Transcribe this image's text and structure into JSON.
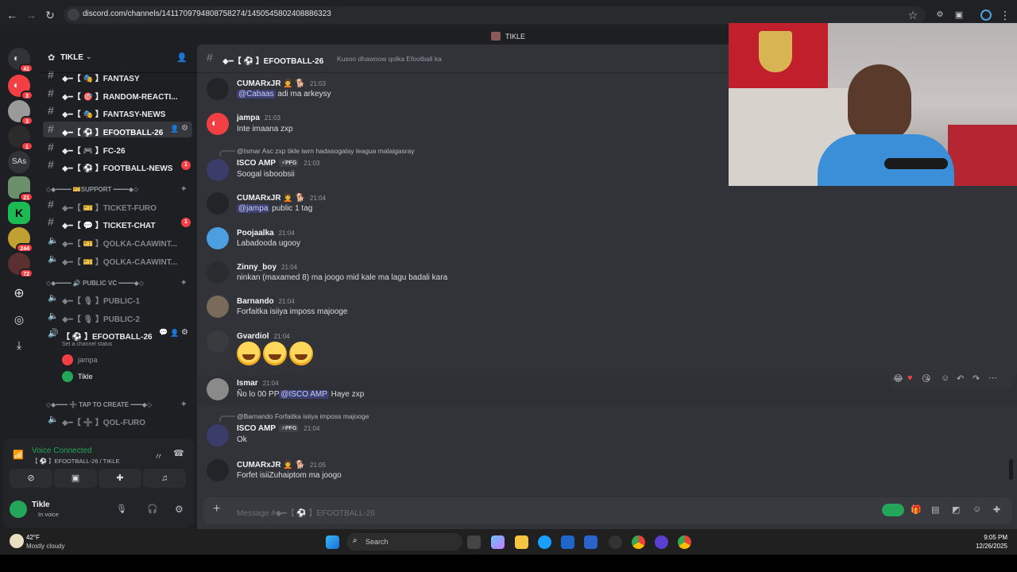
{
  "browser": {
    "url": "discord.com/channels/1411709794808758274/1450545802408886323"
  },
  "app": {
    "window_title": "TIKLE"
  },
  "servers": {
    "home_badge": "41",
    "badges": [
      "3",
      "3",
      "1",
      "21",
      "244",
      "72"
    ],
    "text_server": "SAs"
  },
  "server": {
    "name": "TIKLE"
  },
  "channels": {
    "items": [
      {
        "label": "◆━【 🎭 】FANTASY"
      },
      {
        "label": "◆━【 🎯 】RANDOM-REACTI..."
      },
      {
        "label": "◆━【 🎭 】FANTASY-NEWS"
      },
      {
        "label": "◆━【 ⚽ 】EFOOTBALL-26"
      },
      {
        "label": "◆━【 🎮 】FC-26"
      },
      {
        "label": "◆━【 ⚽ 】FOOTBALL-NEWS",
        "badge": "1"
      }
    ],
    "cat_support": "◇◆━━━━ 🎫SUPPORT ━━━━◆◇",
    "support_items": [
      {
        "label": "◆━【 🎫 】TICKET-FURO"
      },
      {
        "label": "◆━【 💬 】TICKET-CHAT",
        "badge": "1"
      },
      {
        "label": "◆━【 🎫 】QOLKA-CAAWINT..."
      },
      {
        "label": "◆━【 🎫 】QOLKA-CAAWINT..."
      }
    ],
    "cat_public_vc": "◇◆━━━━ 🔊 PUBLIC VC ━━━━◆◇",
    "vc_items": [
      {
        "label": "◆━【 🎙 】PUBLIC-1"
      },
      {
        "label": "◆━【 🎙 】PUBLIC-2"
      }
    ],
    "active_vc": "【 ⚽ 】EFOOTBALL-26",
    "vc_status": "Set a channel status",
    "vc_members": [
      "jampa",
      "Tikle"
    ],
    "cat_tap": "◇◆━━━ ➕ TAP TO CREATE ━━━◆◇",
    "tap_item": "◆━【 ➕ 】QOL-FURO"
  },
  "voice": {
    "status": "Voice Connected",
    "channel": "【 ⚽ 】EFOOTBALL-26 / TIKLE"
  },
  "user": {
    "name": "Tikle",
    "status": "In voice"
  },
  "channel_header": {
    "name": "◆━【 ⚽ 】EFOOTBALL-26",
    "topic": "Kusoo dhawoow qolka Efootball ka"
  },
  "messages": [
    {
      "user": "CUMARxJR 🧑‍🦱 🐕",
      "time": "21:03",
      "mention": "@Cabaas",
      "text": " adi ma arkeysy"
    },
    {
      "user": "jampa",
      "time": "21:03",
      "text": "Inte imaana zxp"
    },
    {
      "reply": "@Ismar Asc zxp tikle iwrn hadasogalay leagua malaigasray",
      "user": "ISCO AMP",
      "tag": "⚡PFG",
      "time": "21:03",
      "text": "Soogal isboobsii"
    },
    {
      "user": "CUMARxJR 🧑‍🦱 🐕",
      "time": "21:04",
      "mention": "@jampa",
      "text": " public 1 tag"
    },
    {
      "user": "Poojaalka",
      "time": "21:04",
      "text": "Labadooda ugooy"
    },
    {
      "user": "Zinny_boy",
      "time": "21:04",
      "text": "ninkan (maxamed 8) ma joogo mid kale ma lagu badali kara"
    },
    {
      "user": "Barnando",
      "time": "21:04",
      "text": "Forfaitka isiiya imposs majooge"
    },
    {
      "user": "Gvardiol",
      "time": "21:04"
    },
    {
      "user": "Ismar",
      "time": "21:04",
      "text_before": "Ño lo 00 PP",
      "mention": "@ISCO AMP",
      "text": " Haye zxp"
    },
    {
      "reply": "@Barnando Forfaitka isiiya imposs majooge",
      "user": "ISCO AMP",
      "tag": "⚡PFG",
      "time": "21:04",
      "text": "Ok"
    },
    {
      "user": "CUMARxJR 🧑‍🦱 🐕",
      "time": "21:05",
      "text": "Forfet isiiZuhaiptom ma joogo"
    }
  ],
  "composer": {
    "placeholder": "Message #◆━【 ⚽ 】EFOOTBALL-26"
  },
  "taskbar": {
    "weather_temp": "42°F",
    "weather_desc": "Mostly cloudy",
    "search": "Search",
    "time": "9:05 PM",
    "date": "12/26/2025"
  },
  "colors": {
    "accent": "#5865f2",
    "danger": "#f23f43",
    "online": "#23a55a"
  }
}
